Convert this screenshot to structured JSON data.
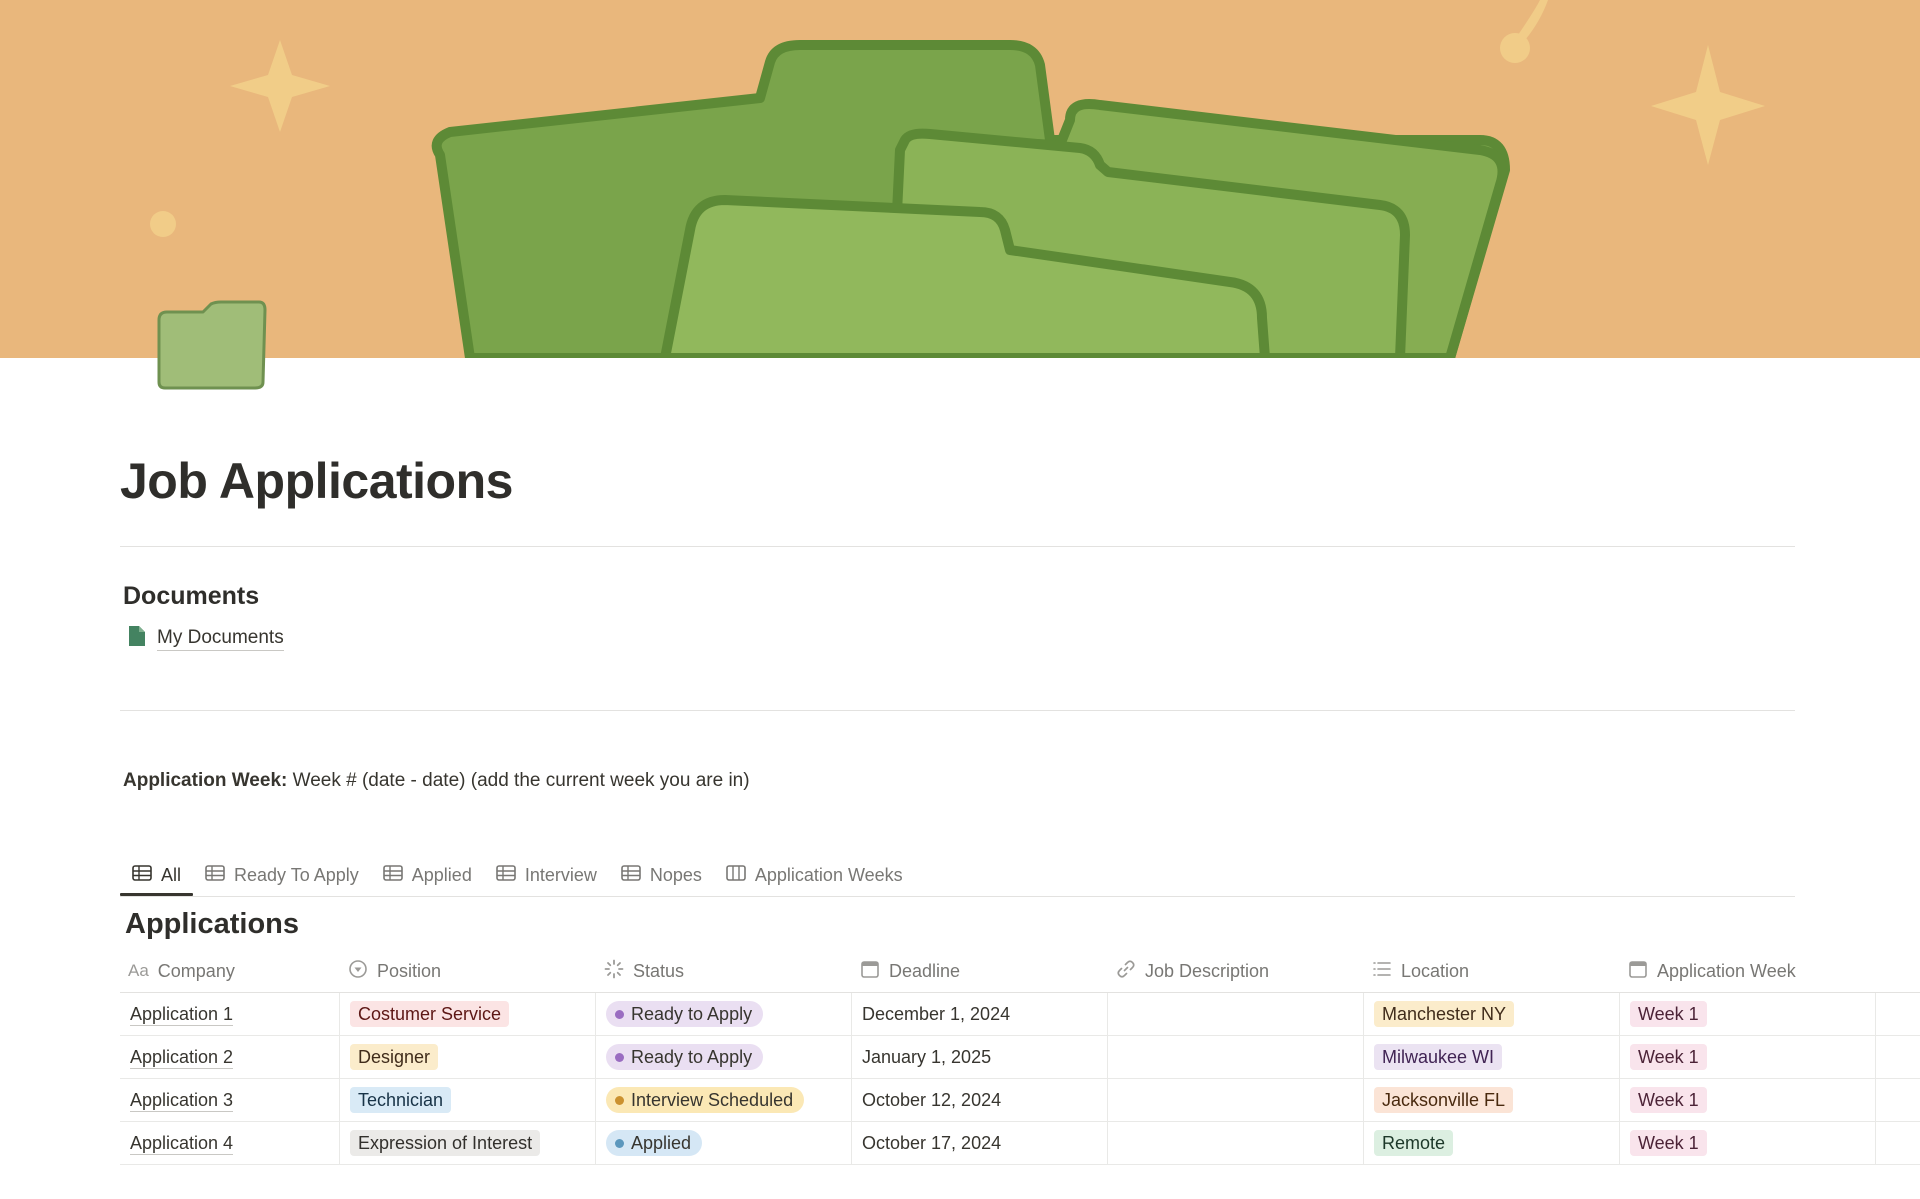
{
  "page": {
    "title": "Job Applications",
    "icon": "folder-icon",
    "cover": "green-folders-cover-illustration"
  },
  "documents": {
    "heading": "Documents",
    "link_label": "My Documents",
    "link_icon": "file-icon"
  },
  "application_week": {
    "label": "Application Week:",
    "value": " Week # (date - date) (add the current week you are in)"
  },
  "tabs": [
    {
      "label": "All",
      "icon": "table-icon",
      "active": true
    },
    {
      "label": "Ready To Apply",
      "icon": "table-icon"
    },
    {
      "label": "Applied",
      "icon": "table-icon"
    },
    {
      "label": "Interview",
      "icon": "table-icon"
    },
    {
      "label": "Nopes",
      "icon": "table-icon"
    },
    {
      "label": "Application Weeks",
      "icon": "board-icon"
    }
  ],
  "database": {
    "title": "Applications",
    "columns": [
      {
        "label": "Company",
        "icon": "text-icon"
      },
      {
        "label": "Position",
        "icon": "select-icon"
      },
      {
        "label": "Status",
        "icon": "status-icon"
      },
      {
        "label": "Deadline",
        "icon": "calendar-icon"
      },
      {
        "label": "Job Description",
        "icon": "link-icon"
      },
      {
        "label": "Location",
        "icon": "list-icon"
      },
      {
        "label": "Application Week",
        "icon": "calendar-icon"
      }
    ],
    "rows": [
      {
        "company": "Application 1",
        "position": "Costumer Service",
        "position_color": "red",
        "status": "Ready to Apply",
        "status_color": "purple",
        "deadline": "December 1, 2024",
        "job_description": "",
        "location": "Manchester NY",
        "location_color": "yellow",
        "week": "Week 1"
      },
      {
        "company": "Application 2",
        "position": "Designer",
        "position_color": "yellow",
        "status": "Ready to Apply",
        "status_color": "purple",
        "deadline": "January 1, 2025",
        "job_description": "",
        "location": "Milwaukee WI",
        "location_color": "purple",
        "week": "Week 1"
      },
      {
        "company": "Application 3",
        "position": "Technician",
        "position_color": "blue",
        "status": "Interview Scheduled",
        "status_color": "yellow",
        "deadline": "October 12, 2024",
        "job_description": "",
        "location": "Jacksonville FL",
        "location_color": "orange",
        "week": "Week 1"
      },
      {
        "company": "Application 4",
        "position": "Expression of Interest",
        "position_color": "gray",
        "status": "Applied",
        "status_color": "blue",
        "deadline": "October 17, 2024",
        "job_description": "",
        "location": "Remote",
        "location_color": "green",
        "week": "Week 1"
      }
    ]
  },
  "colors": {
    "tag_bg": {
      "red": "#fbe4e4",
      "yellow": "#fbeccb",
      "blue": "#d9eaf6",
      "gray": "#ebeae8",
      "purple": "#ebe3f2",
      "orange": "#fbe4d6",
      "green": "#dcefe1",
      "pink": "#f9e4ec"
    },
    "tag_fg": {
      "red": "#5d1715",
      "yellow": "#402c1b",
      "blue": "#183347",
      "gray": "#32302c",
      "purple": "#412454",
      "orange": "#49290e",
      "green": "#1c3829",
      "pink": "#4c2337"
    },
    "status_bg": {
      "purple": "#eadff2",
      "yellow": "#fbe8b5",
      "blue": "#d5e7f5"
    },
    "status_dot": {
      "purple": "#9a6dc1",
      "yellow": "#cb912f",
      "blue": "#5b97bd"
    },
    "week_tag": "pink",
    "cover_bg": "#e8b57a",
    "folder_green": "#76a24a"
  }
}
